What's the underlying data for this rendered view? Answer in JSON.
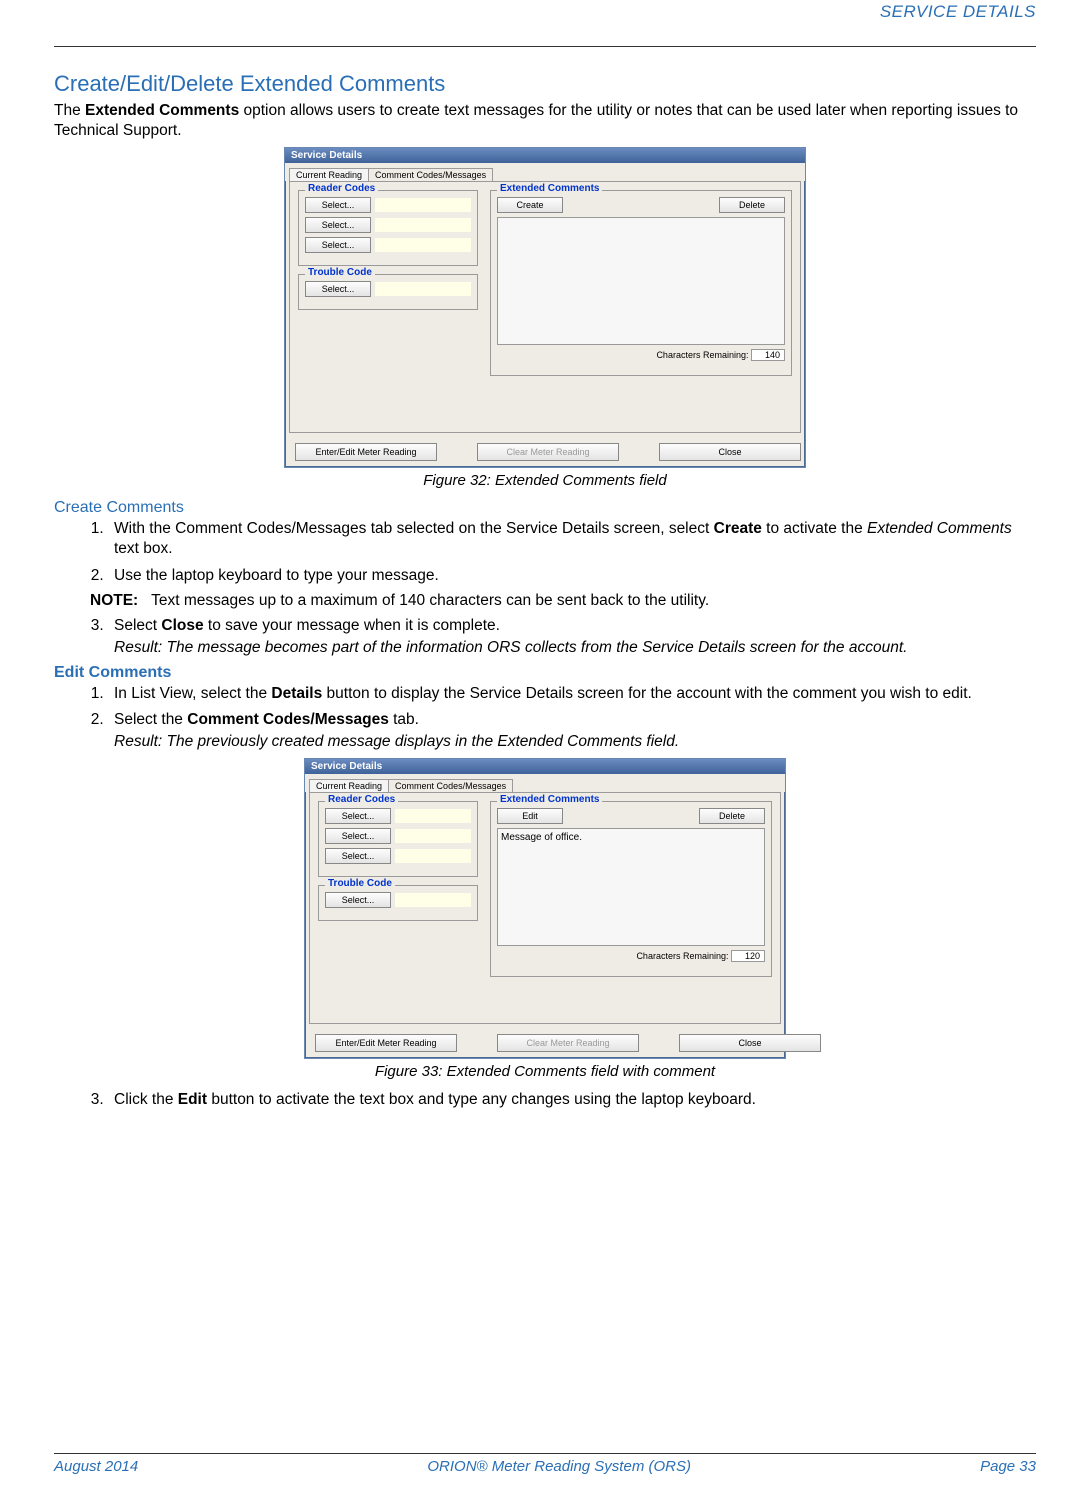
{
  "header": {
    "label": "SERVICE DETAILS"
  },
  "section": {
    "title": "Create/Edit/Delete Extended Comments",
    "intro_pre": "The ",
    "intro_bold": "Extended Comments",
    "intro_post": " option allows users to create text messages for the utility or notes that can be used later when reporting issues to Technical Support."
  },
  "fig32": {
    "caption": "Figure 32:  Extended Comments field",
    "win_title": "Service Details",
    "tab1": "Current Reading",
    "tab2": "Comment Codes/Messages",
    "reader_codes": "Reader Codes",
    "trouble_code": "Trouble Code",
    "select": "Select...",
    "ext_comments": "Extended Comments",
    "create": "Create",
    "delete": "Delete",
    "chars_label": "Characters Remaining:",
    "chars_val": "140",
    "textbox": "",
    "btn1": "Enter/Edit Meter Reading",
    "btn2": "Clear Meter Reading",
    "btn3": "Close"
  },
  "create": {
    "head": "Create Comments",
    "s1_pre": "With the Comment Codes/Messages tab selected on the Service Details screen, select ",
    "s1_bold": "Create",
    "s1_mid": " to activate the ",
    "s1_it": "Extended Comments",
    "s1_post": " text box.",
    "s2": "Use the laptop keyboard to type your message.",
    "note_label": "NOTE:",
    "note_text": "Text messages up to a maximum of 140 characters can be sent back to the utility.",
    "s3_pre": "Select ",
    "s3_bold": "Close",
    "s3_post": " to save your message when it is complete.",
    "s3_result": "Result: The message becomes part of the information ORS collects from the Service Details screen for the account."
  },
  "edit": {
    "head": "Edit Comments",
    "s1_pre": "In List View, select the ",
    "s1_bold": "Details",
    "s1_post": " button to display the Service Details screen for the account with the comment you wish to edit.",
    "s2_pre": "Select the ",
    "s2_bold": "Comment Codes/Messages",
    "s2_post": " tab.",
    "s2_result": "Result: The previously created message displays in the Extended Comments field."
  },
  "fig33": {
    "caption": "Figure 33:  Extended Comments field with comment",
    "edit": "Edit",
    "textbox": "Message of office.",
    "chars_val": "120"
  },
  "after33": {
    "s3_pre": "Click the ",
    "s3_bold": "Edit",
    "s3_post": " button to activate the text box and type any changes using the laptop keyboard."
  },
  "footer": {
    "left": "August 2014",
    "center": "ORION® Meter Reading System (ORS)",
    "right": "Page 33"
  }
}
